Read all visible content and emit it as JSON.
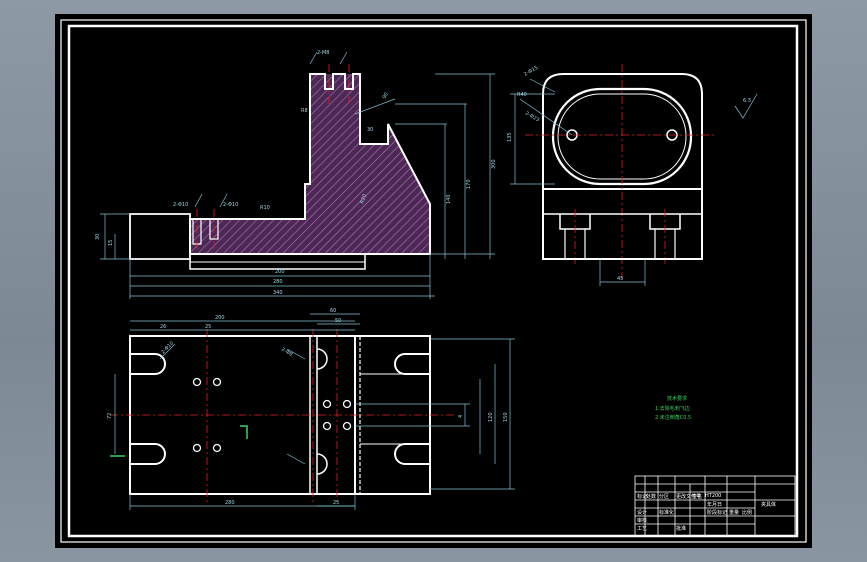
{
  "dimensions": {
    "front": [
      "200",
      "280",
      "340",
      "30",
      "15",
      "170",
      "140",
      "300",
      "90",
      "30",
      "R8",
      "R10",
      "R20",
      "2-M8",
      "2-Φ10",
      "2-Φ10"
    ],
    "side": [
      "2-Φ15",
      "R40",
      "2-Φ23",
      "135",
      "45",
      "6.3"
    ],
    "top": [
      "200",
      "60",
      "26",
      "25",
      "50",
      "280",
      "25",
      "72",
      "120",
      "150",
      "4",
      "2-Φ10",
      "2-Φ8"
    ]
  },
  "notes": {
    "title": "技术要求",
    "lines": [
      "1.去除毛刺飞边",
      "2.未注倒角C0.5"
    ]
  },
  "title_block": {
    "part_name": "夹具体",
    "material": "HT200",
    "row_labels": [
      "标记",
      "处数",
      "分区",
      "更改文件号",
      "签名",
      "年月日"
    ],
    "sub_labels": [
      "设计",
      "标准化",
      "审核",
      "工艺",
      "批准"
    ],
    "scale_labels": [
      "阶段标记",
      "重量",
      "比例"
    ]
  }
}
